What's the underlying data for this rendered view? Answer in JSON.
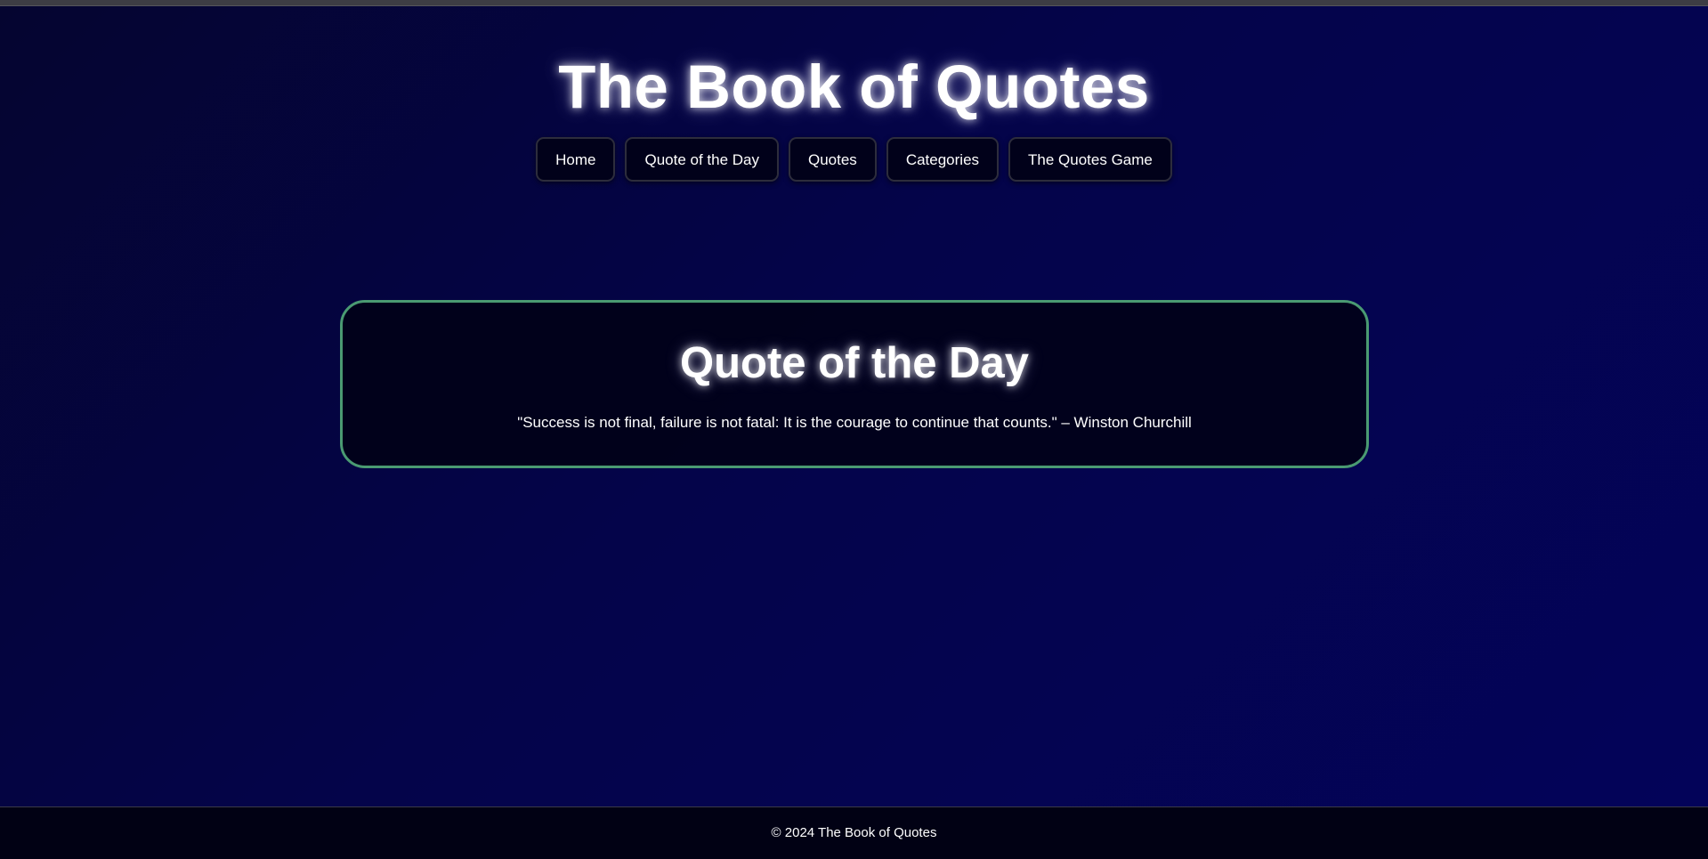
{
  "header": {
    "title": "The Book of Quotes",
    "nav": [
      {
        "label": "Home"
      },
      {
        "label": "Quote of the Day"
      },
      {
        "label": "Quotes"
      },
      {
        "label": "Categories"
      },
      {
        "label": "The Quotes Game"
      }
    ]
  },
  "main": {
    "card_title": "Quote of the Day",
    "quote": "\"Success is not final, failure is not fatal: It is the courage to continue that counts.\" – Winston Churchill"
  },
  "footer": {
    "text": "© 2024 The Book of Quotes"
  },
  "colors": {
    "background": "#04044a",
    "card_border": "#4a9a72",
    "nav_button_bg": "#01011a",
    "text": "#ffffff"
  }
}
